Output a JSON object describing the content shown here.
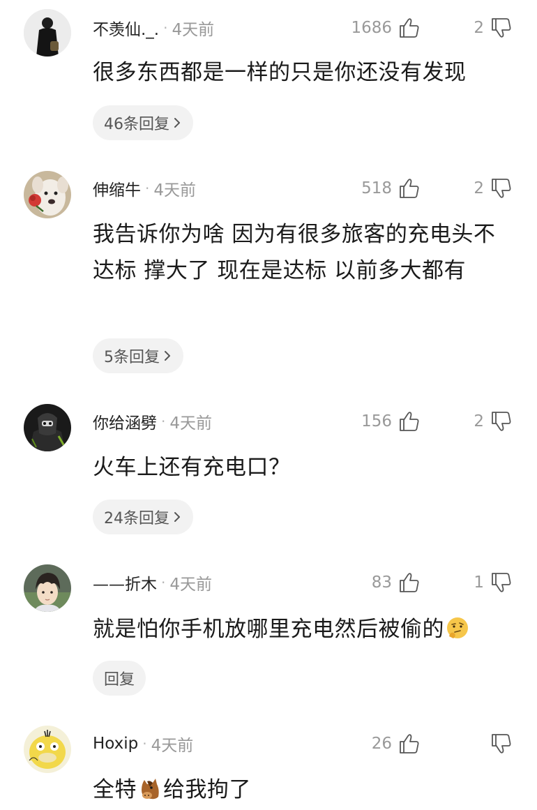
{
  "comments": [
    {
      "username": "不羡仙._.",
      "dot": "·",
      "time": "4天前",
      "likes": "1686",
      "dislikes": "2",
      "text": "很多东西都是一样的只是你还没有发现",
      "reply_label": "46条回复",
      "avatar_icon": "person-in-black-coat-avatar"
    },
    {
      "username": "伸缩牛",
      "dot": "·",
      "time": "4天前",
      "likes": "518",
      "dislikes": "2",
      "text": "我告诉你为啥 因为有很多旅客的充电头不达标 撑大了 现在是达标 以前多大都有",
      "reply_label": "5条回复",
      "avatar_icon": "dog-with-rose-avatar"
    },
    {
      "username": "你给涵劈",
      "dot": "·",
      "time": "4天前",
      "likes": "156",
      "dislikes": "2",
      "text": "火车上还有充电口？",
      "reply_label": "24条回复",
      "avatar_icon": "masked-figure-avatar"
    },
    {
      "username": "——折木",
      "dot": "·",
      "time": "4天前",
      "likes": "83",
      "dislikes": "1",
      "text": "就是怕你手机放哪里充电然后被偷的",
      "reply_label": "回复",
      "avatar_icon": "anime-boy-avatar",
      "emoji_icon": "thinking-face-emoji"
    },
    {
      "username": "Hoxip",
      "dot": "·",
      "time": "4天前",
      "likes": "26",
      "dislikes": "",
      "text_before": "全特",
      "text_after": "给我拘了",
      "avatar_icon": "psyduck-avatar",
      "emoji_icon": "horse-face-emoji"
    }
  ]
}
